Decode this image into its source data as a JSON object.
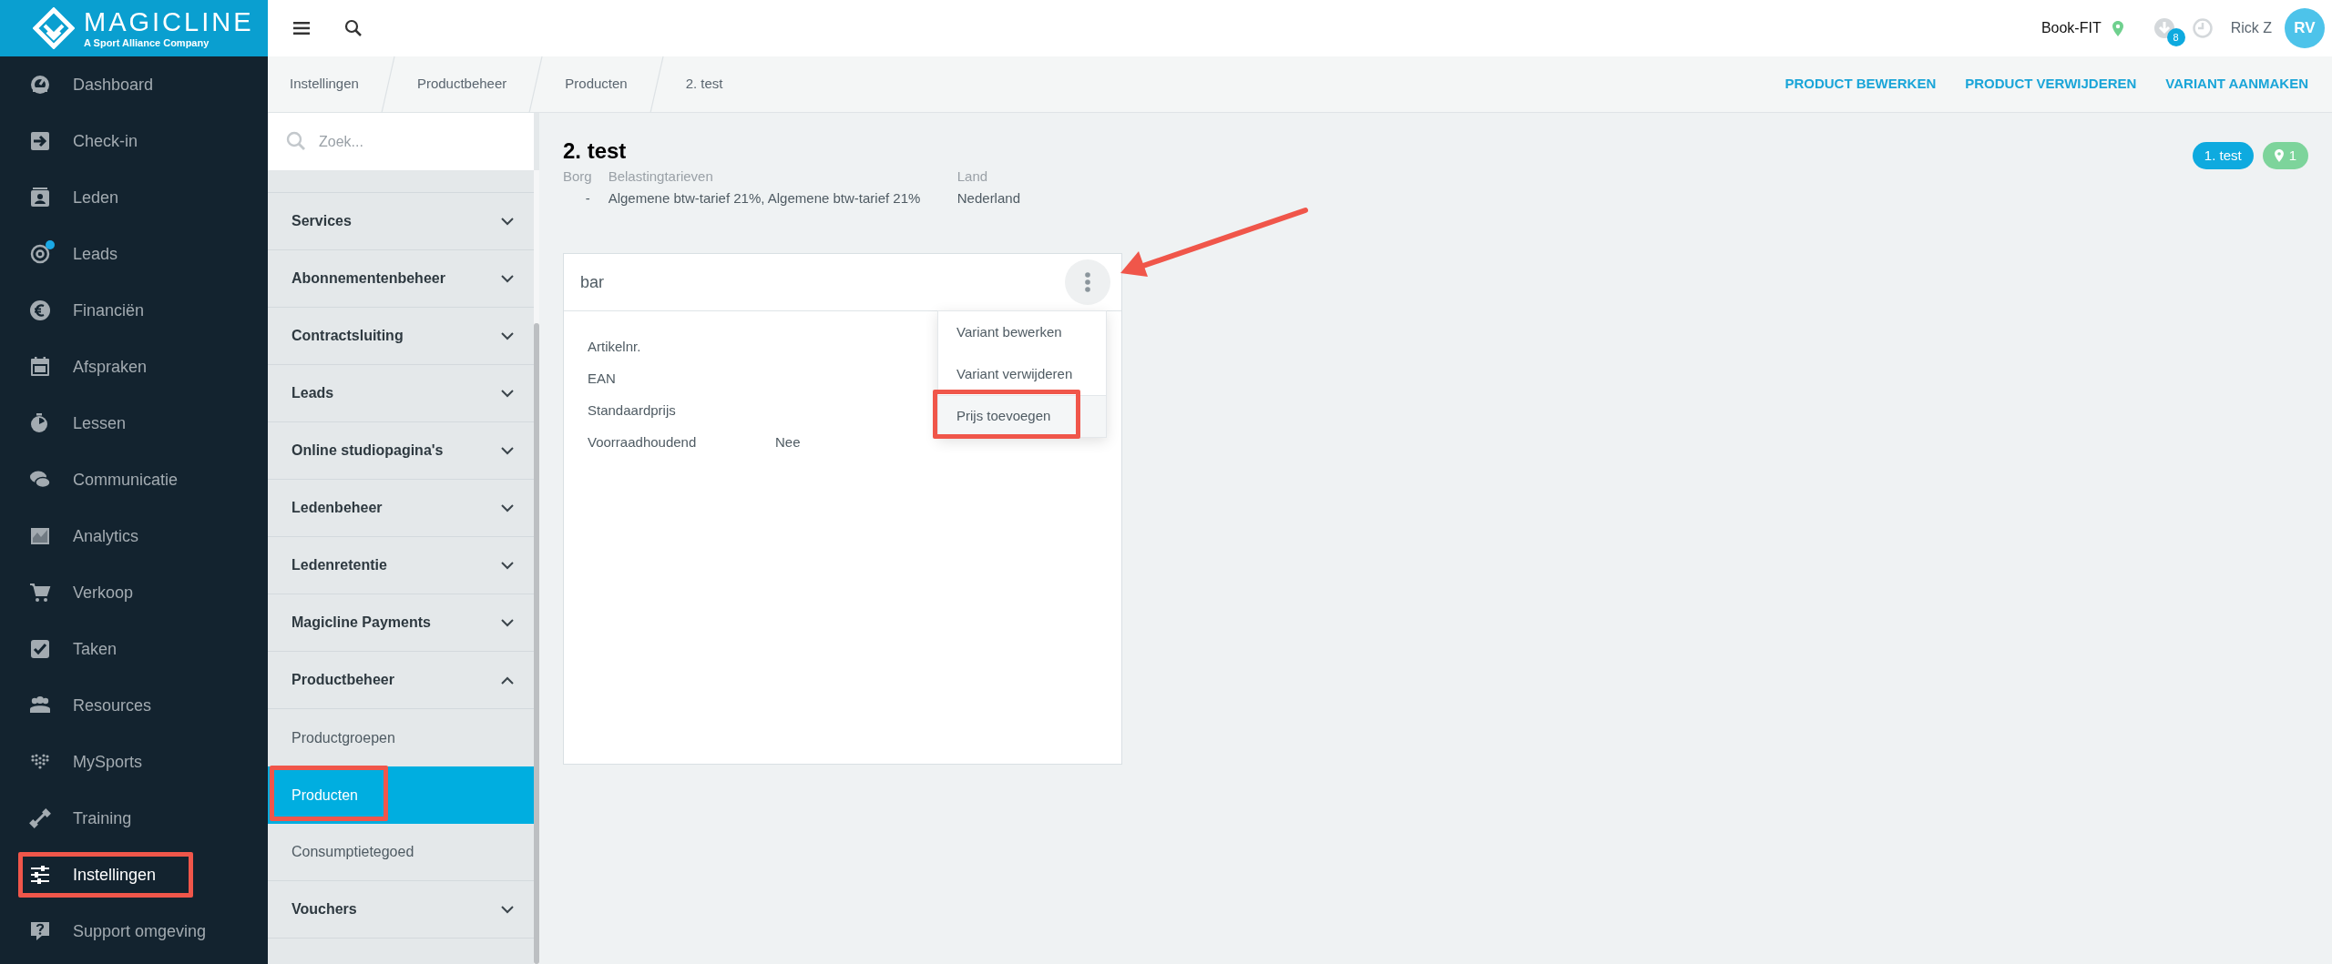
{
  "logo": {
    "name": "MAGICLINE",
    "tagline": "A Sport Alliance Company"
  },
  "nav": [
    {
      "label": "Dashboard",
      "selected": false,
      "highlighted": false,
      "notification": false
    },
    {
      "label": "Check-in",
      "selected": false,
      "highlighted": false,
      "notification": false
    },
    {
      "label": "Leden",
      "selected": false,
      "highlighted": false,
      "notification": false
    },
    {
      "label": "Leads",
      "selected": false,
      "highlighted": false,
      "notification": true
    },
    {
      "label": "Financiën",
      "selected": false,
      "highlighted": false,
      "notification": false
    },
    {
      "label": "Afspraken",
      "selected": false,
      "highlighted": false,
      "notification": false
    },
    {
      "label": "Lessen",
      "selected": false,
      "highlighted": false,
      "notification": false
    },
    {
      "label": "Communicatie",
      "selected": false,
      "highlighted": false,
      "notification": false
    },
    {
      "label": "Analytics",
      "selected": false,
      "highlighted": false,
      "notification": false
    },
    {
      "label": "Verkoop",
      "selected": false,
      "highlighted": false,
      "notification": false
    },
    {
      "label": "Taken",
      "selected": false,
      "highlighted": false,
      "notification": false
    },
    {
      "label": "Resources",
      "selected": false,
      "highlighted": false,
      "notification": false
    },
    {
      "label": "MySports",
      "selected": false,
      "highlighted": false,
      "notification": false
    },
    {
      "label": "Training",
      "selected": false,
      "highlighted": false,
      "notification": false
    },
    {
      "label": "Instellingen",
      "selected": true,
      "highlighted": true,
      "notification": false
    },
    {
      "label": "Support omgeving",
      "selected": false,
      "highlighted": false,
      "notification": false
    }
  ],
  "topbar": {
    "studio": "Book-FIT",
    "download_count": "8",
    "user": "Rick Z",
    "avatar": "RV"
  },
  "breadcrumbs": [
    "Instellingen",
    "Productbeheer",
    "Producten",
    "2. test"
  ],
  "actions": [
    "PRODUCT BEWERKEN",
    "PRODUCT VERWIJDEREN",
    "VARIANT AANMAKEN"
  ],
  "settings_menu": {
    "search_placeholder": "Zoek...",
    "items": [
      {
        "label": "Services",
        "kind": "group",
        "expanded": false,
        "selected": false,
        "highlighted": false
      },
      {
        "label": "Abonnementenbeheer",
        "kind": "group",
        "expanded": false,
        "selected": false,
        "highlighted": false
      },
      {
        "label": "Contractsluiting",
        "kind": "group",
        "expanded": false,
        "selected": false,
        "highlighted": false
      },
      {
        "label": "Leads",
        "kind": "group",
        "expanded": false,
        "selected": false,
        "highlighted": false
      },
      {
        "label": "Online studiopagina's",
        "kind": "group",
        "expanded": false,
        "selected": false,
        "highlighted": false
      },
      {
        "label": "Ledenbeheer",
        "kind": "group",
        "expanded": false,
        "selected": false,
        "highlighted": false
      },
      {
        "label": "Ledenretentie",
        "kind": "group",
        "expanded": false,
        "selected": false,
        "highlighted": false
      },
      {
        "label": "Magicline Payments",
        "kind": "group",
        "expanded": false,
        "selected": false,
        "highlighted": false
      },
      {
        "label": "Productbeheer",
        "kind": "group",
        "expanded": true,
        "selected": false,
        "highlighted": false
      },
      {
        "label": "Productgroepen",
        "kind": "link",
        "selected": false,
        "highlighted": false
      },
      {
        "label": "Producten",
        "kind": "link",
        "selected": true,
        "highlighted": true
      },
      {
        "label": "Consumptietegoed",
        "kind": "link",
        "selected": false,
        "highlighted": false
      },
      {
        "label": "Vouchers",
        "kind": "group",
        "expanded": false,
        "selected": false,
        "highlighted": false
      }
    ]
  },
  "product": {
    "title": "2. test",
    "fields": [
      {
        "label": "Borg",
        "value": "-"
      },
      {
        "label": "Belastingtarieven",
        "value": "Algemene btw-tarief 21%, Algemene btw-tarief 21%"
      },
      {
        "label": "Land",
        "value": "Nederland"
      }
    ],
    "tags": [
      {
        "kind": "variant",
        "text": "1. test"
      },
      {
        "kind": "location",
        "text": "1"
      }
    ]
  },
  "variant_card": {
    "title": "bar",
    "rows": [
      {
        "label": "Artikelnr."
      },
      {
        "label": "EAN"
      },
      {
        "label": "Standaardprijs"
      },
      {
        "label": "Voorraadhoudend",
        "value": "Nee"
      }
    ]
  },
  "context_menu": {
    "items": [
      {
        "label": "Variant bewerken",
        "hovered": false,
        "highlighted": false
      },
      {
        "label": "Variant verwijderen",
        "hovered": false,
        "highlighted": false
      },
      {
        "label": "Prijs toevoegen",
        "hovered": true,
        "highlighted": true
      }
    ]
  }
}
